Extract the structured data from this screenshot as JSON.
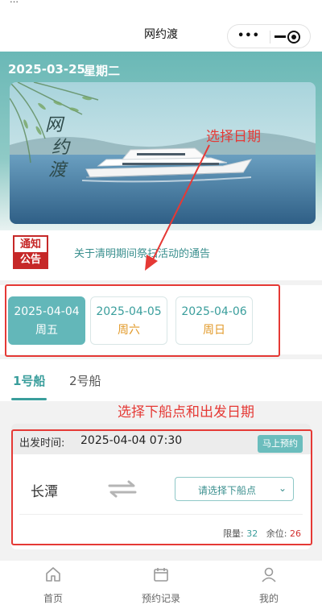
{
  "status_bar": {
    "partial_text": "…"
  },
  "navbar": {
    "title": "网约渡",
    "more_icon": "more-dots-icon",
    "minimize_icon": "minus-icon",
    "close_icon": "target-icon"
  },
  "header": {
    "date": "2025-03-25",
    "weekday": "星期二",
    "banner_calligraphy": [
      "网",
      "约",
      "渡"
    ]
  },
  "notice": {
    "badge_top": "通知",
    "badge_bottom": "公告",
    "text": "关于清明期间祭扫活动的通告"
  },
  "dates": [
    {
      "date": "2025-04-04",
      "weekday": "周五",
      "selected": true
    },
    {
      "date": "2025-04-05",
      "weekday": "周六",
      "selected": false
    },
    {
      "date": "2025-04-06",
      "weekday": "周日",
      "selected": false
    }
  ],
  "tabs": [
    {
      "label": "1号船",
      "active": true
    },
    {
      "label": "2号船",
      "active": false
    }
  ],
  "trip": {
    "depart_label": "出发时间:",
    "depart_time": "2025-04-04 07:30",
    "book_button": "马上预约",
    "origin": "长潭",
    "destination_placeholder": "请选择下船点",
    "limit_label": "限量:",
    "limit_value": "32",
    "remain_label": "余位:",
    "remain_value": "26"
  },
  "annotations": {
    "select_date": "选择日期",
    "select_stop_and_date": "选择下船点和出发日期"
  },
  "bottom_nav": [
    {
      "label": "首页",
      "icon": "home-icon"
    },
    {
      "label": "预约记录",
      "icon": "calendar-icon"
    },
    {
      "label": "我的",
      "icon": "user-icon"
    }
  ],
  "colors": {
    "accent": "#3a9e9c",
    "selected_card": "#63b7b9",
    "annotation_red": "#e53935",
    "notice_red": "#c62828"
  }
}
